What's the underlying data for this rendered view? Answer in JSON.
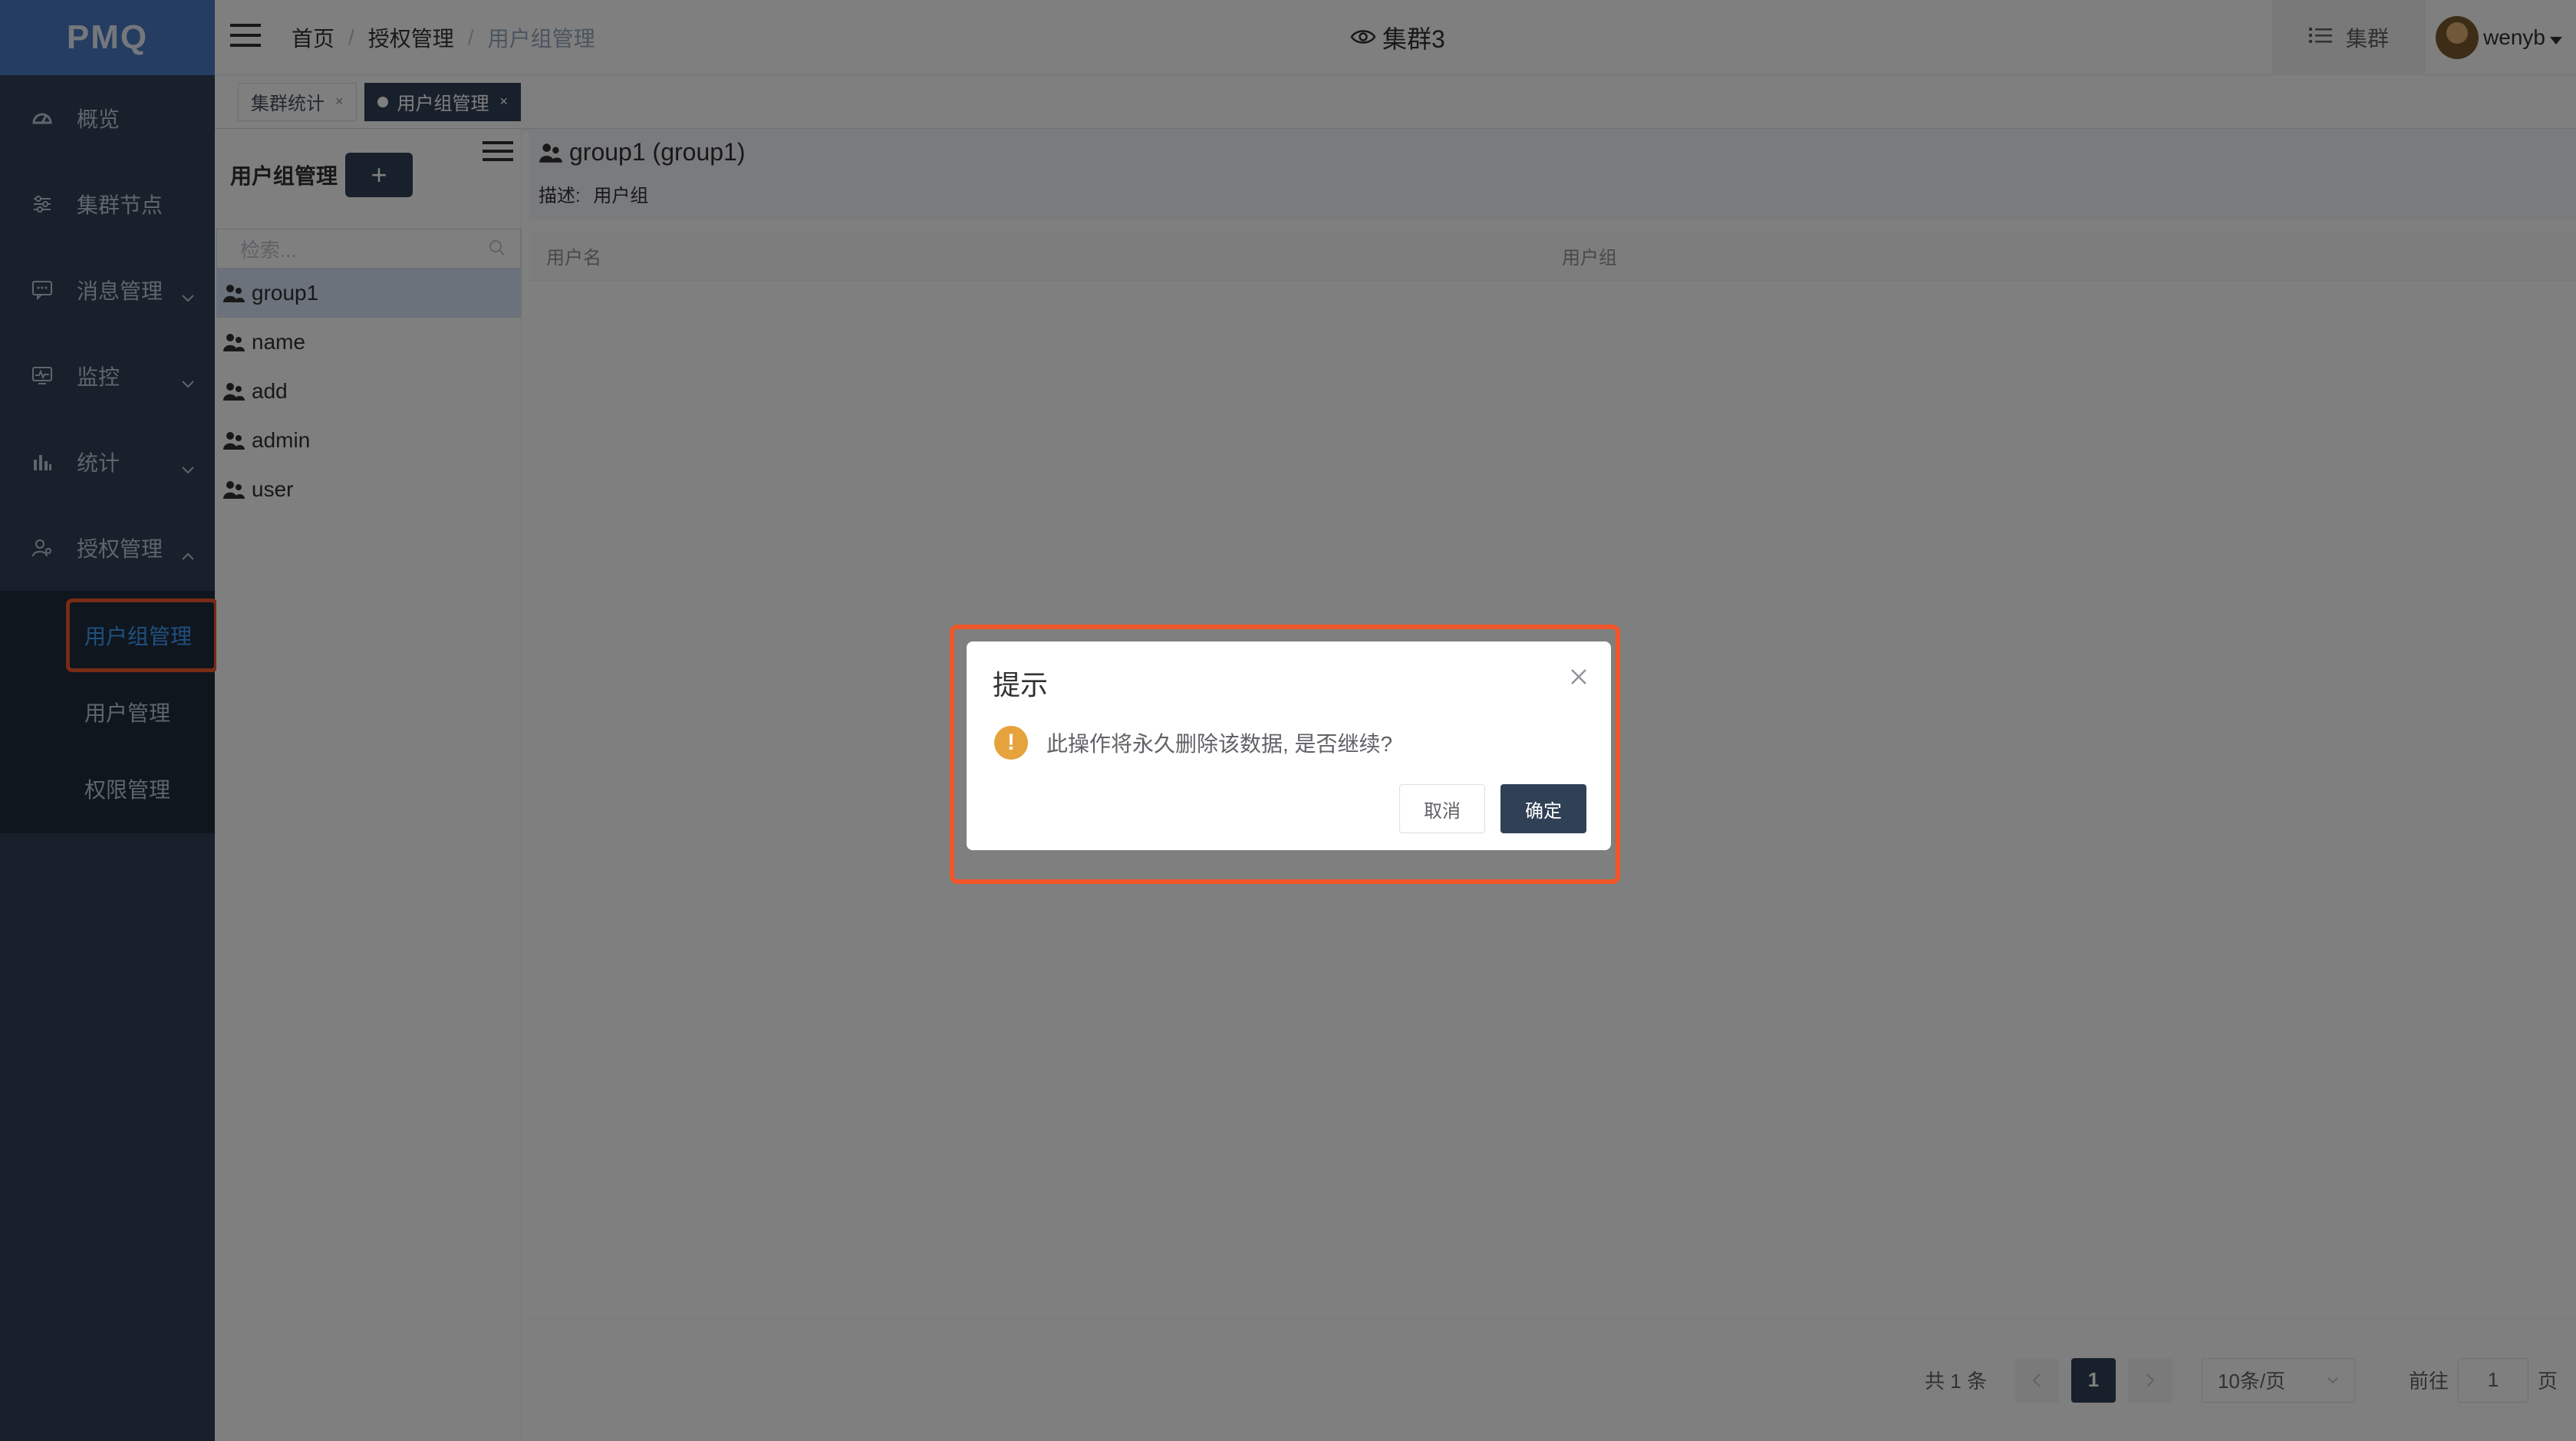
{
  "app": {
    "logo_text": "PMQ"
  },
  "sidebar": {
    "items": [
      {
        "label": "概览",
        "icon": "dashboard-icon"
      },
      {
        "label": "集群节点",
        "icon": "sliders-icon"
      },
      {
        "label": "消息管理",
        "icon": "message-icon",
        "expandable": true
      },
      {
        "label": "监控",
        "icon": "monitor-icon",
        "expandable": true
      },
      {
        "label": "统计",
        "icon": "bar-chart-icon",
        "expandable": true
      },
      {
        "label": "授权管理",
        "icon": "user-auth-icon",
        "expandable": true,
        "expanded": true
      }
    ],
    "subitems": [
      {
        "label": "用户组管理",
        "active": true
      },
      {
        "label": "用户管理"
      },
      {
        "label": "权限管理"
      }
    ]
  },
  "header": {
    "breadcrumb": [
      "首页",
      "授权管理",
      "用户组管理"
    ],
    "breadcrumb_sep": "/",
    "cluster_name": "集群3",
    "cluster_button": "集群",
    "username": "wenyb"
  },
  "tabs": [
    {
      "label": "集群统计",
      "active": false
    },
    {
      "label": "用户组管理",
      "active": true
    }
  ],
  "group_panel": {
    "title": "用户组管理",
    "add_label": "+",
    "search_placeholder": "检索...",
    "groups": [
      "group1",
      "name",
      "add",
      "admin",
      "user"
    ],
    "selected": "group1"
  },
  "detail": {
    "title": "group1 (group1)",
    "desc_label": "描述:",
    "desc_value": "用户组",
    "columns": [
      "用户名",
      "用户组"
    ]
  },
  "pagination": {
    "total_text": "共 1 条",
    "current_page": "1",
    "page_size": "10条/页",
    "goto_label": "前往",
    "goto_value": "1",
    "page_unit": "页"
  },
  "dialog": {
    "title": "提示",
    "message": "此操作将永久删除该数据, 是否继续?",
    "cancel": "取消",
    "confirm": "确定",
    "warn_glyph": "!"
  },
  "colors": {
    "sidebar_bg": "#304156",
    "logo_bg": "#4b7ac3",
    "accent": "#409eff",
    "highlight": "#f0562a",
    "warning": "#e6a23c"
  }
}
